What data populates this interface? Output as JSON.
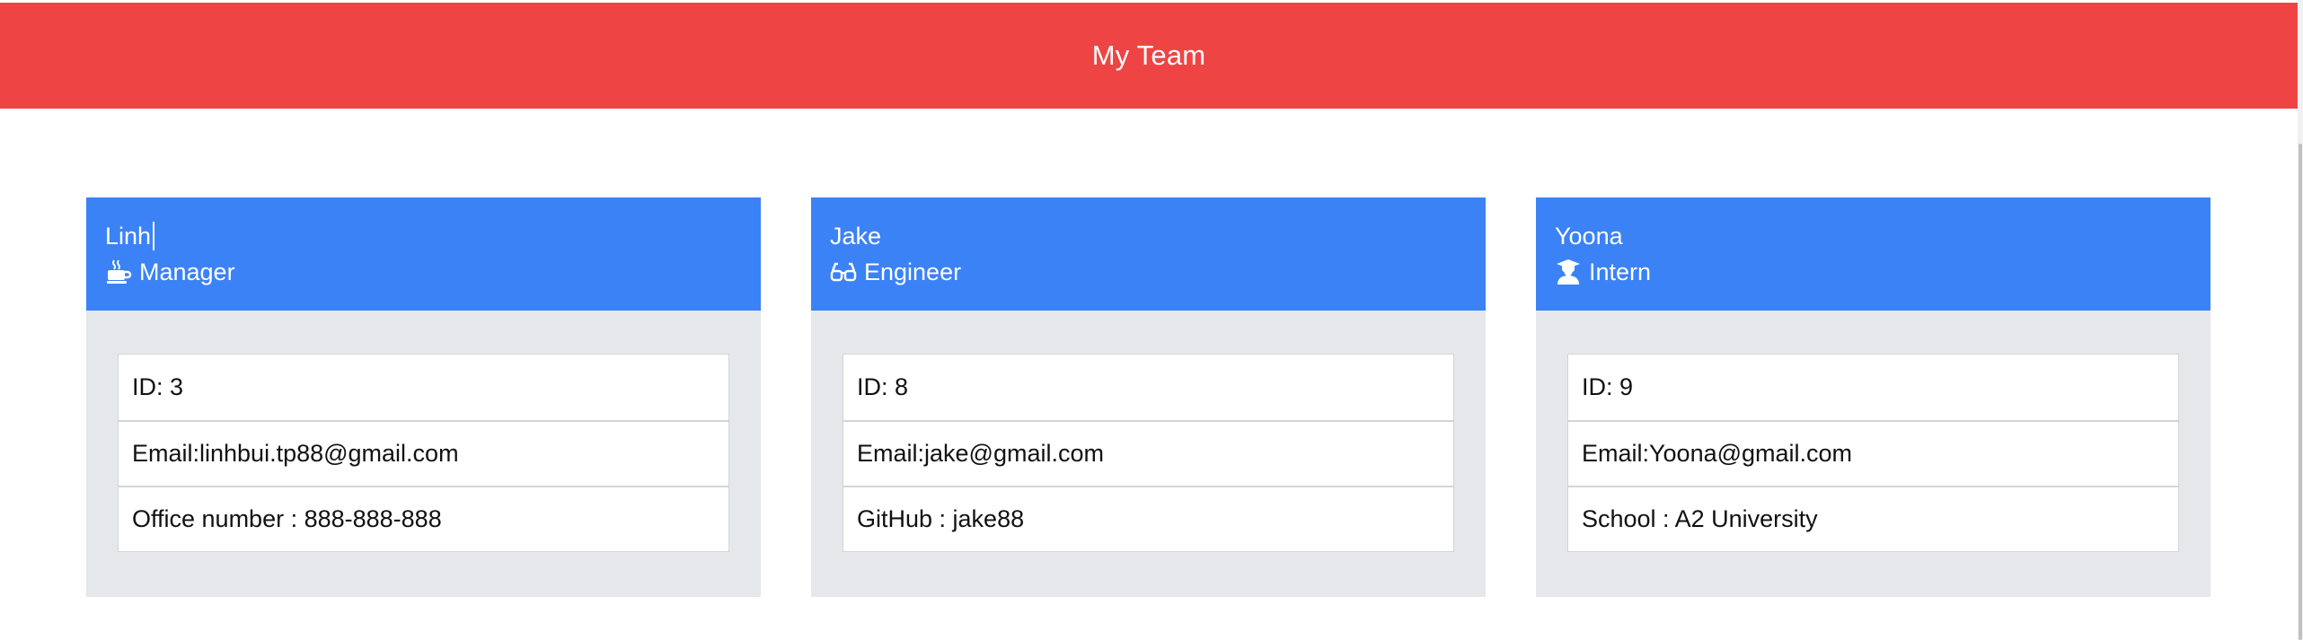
{
  "header": {
    "title": "My Team",
    "color": "#ef4444"
  },
  "theme": {
    "card_header_color": "#3b82f6",
    "card_body_color": "#e5e7eb"
  },
  "team": [
    {
      "name": "Linh",
      "role": "Manager",
      "role_icon": "coffee-mug-icon",
      "details": [
        "ID: 3",
        "Email:linhbui.tp88@gmail.com",
        "Office number : 888-888-888"
      ]
    },
    {
      "name": "Jake",
      "role": "Engineer",
      "role_icon": "glasses-icon",
      "details": [
        "ID: 8",
        "Email:jake@gmail.com",
        "GitHub : jake88"
      ]
    },
    {
      "name": "Yoona",
      "role": "Intern",
      "role_icon": "graduate-user-icon",
      "details": [
        "ID: 9",
        "Email:Yoona@gmail.com",
        "School : A2 University"
      ]
    }
  ]
}
